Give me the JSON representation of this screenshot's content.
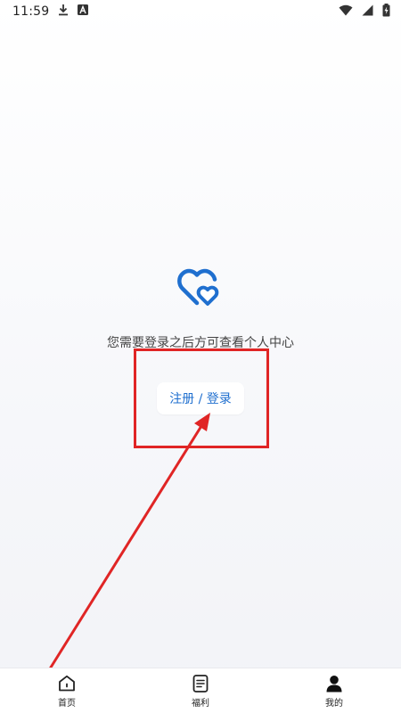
{
  "status_bar": {
    "time": "11:59",
    "icons": [
      "download-icon",
      "a-notification-icon",
      "wifi-icon",
      "cellular-signal-icon",
      "battery-charging-icon"
    ]
  },
  "empty_state": {
    "icon": "hearts-icon",
    "message": "您需要登录之后方可查看个人中心",
    "button_label": "注册 / 登录"
  },
  "bottom_nav": {
    "items": [
      {
        "label": "首页",
        "icon": "home-icon"
      },
      {
        "label": "福利",
        "icon": "document-icon"
      },
      {
        "label": "我的",
        "icon": "person-icon"
      }
    ]
  },
  "colors": {
    "accent": "#1f6fcf",
    "annotation": "#e02525",
    "background_top": "#ffffff",
    "background_bottom": "#f2f3f7"
  }
}
